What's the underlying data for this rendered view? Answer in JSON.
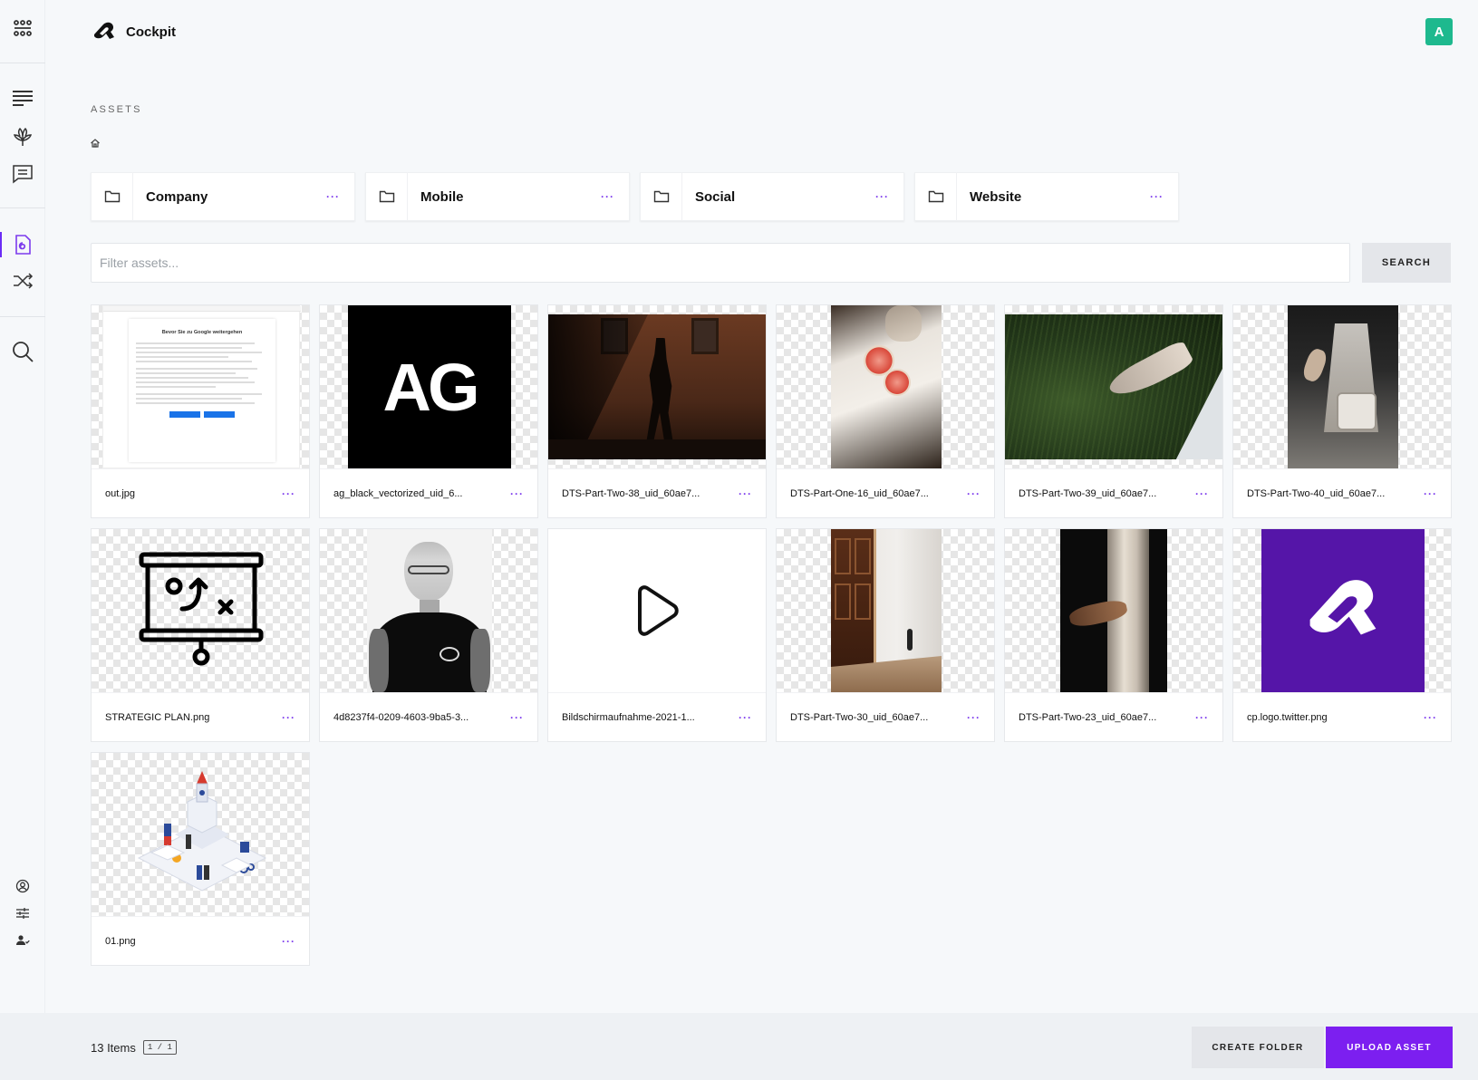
{
  "app": {
    "name": "Cockpit",
    "avatar_initial": "A",
    "accent": "#7c1ff0",
    "avatar_color": "#1eb98e"
  },
  "page": {
    "section_title": "ASSETS"
  },
  "sidebar": {
    "icons": [
      "modules-icon",
      "list-icon",
      "plant-icon",
      "messages-icon",
      "assets-icon",
      "shuffle-icon",
      "search-icon",
      "account-icon",
      "settings-icon",
      "users-icon"
    ],
    "active": "assets-icon"
  },
  "folders": [
    {
      "label": "Company"
    },
    {
      "label": "Mobile"
    },
    {
      "label": "Social"
    },
    {
      "label": "Website"
    }
  ],
  "filter": {
    "placeholder": "Filter assets...",
    "button": "SEARCH"
  },
  "assets": [
    {
      "name": "out.jpg"
    },
    {
      "name": "ag_black_vectorized_uid_6..."
    },
    {
      "name": "DTS-Part-Two-38_uid_60ae7..."
    },
    {
      "name": "DTS-Part-One-16_uid_60ae7..."
    },
    {
      "name": "DTS-Part-Two-39_uid_60ae7..."
    },
    {
      "name": "DTS-Part-Two-40_uid_60ae7..."
    },
    {
      "name": "STRATEGIC PLAN.png"
    },
    {
      "name": "4d8237f4-0209-4603-9ba5-3..."
    },
    {
      "name": "Bildschirmaufnahme-2021-1..."
    },
    {
      "name": "DTS-Part-Two-30_uid_60ae7..."
    },
    {
      "name": "DTS-Part-Two-23_uid_60ae7..."
    },
    {
      "name": "cp.logo.twitter.png"
    },
    {
      "name": "01.png"
    }
  ],
  "thumb_text": {
    "ag_logo": "AG",
    "google_heading": "Bevor Sie zu Google weitergehen"
  },
  "footer": {
    "items_count": "13 Items",
    "pager": "1 / 1",
    "create_folder": "CREATE FOLDER",
    "upload_asset": "UPLOAD ASSET"
  },
  "more_glyph": "···"
}
